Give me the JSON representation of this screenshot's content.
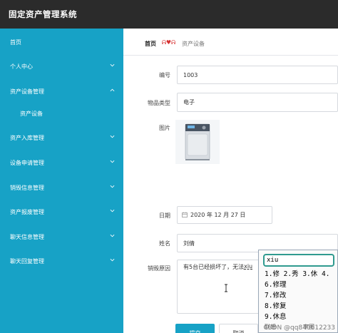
{
  "app": {
    "title": "固定资产管理系统"
  },
  "sidebar": {
    "items": [
      {
        "label": "首页",
        "chevron": ""
      },
      {
        "label": "个人中心",
        "chevron": "down"
      },
      {
        "label": "资产设备管理",
        "chevron": "up"
      },
      {
        "label": "资产设备",
        "chevron": ""
      },
      {
        "label": "资产入库管理",
        "chevron": "down"
      },
      {
        "label": "设备申请管理",
        "chevron": "down"
      },
      {
        "label": "销毁信息管理",
        "chevron": "down"
      },
      {
        "label": "资产报废管理",
        "chevron": "down"
      },
      {
        "label": "聊天信息管理",
        "chevron": "down"
      },
      {
        "label": "聊天回复管理",
        "chevron": "down"
      }
    ]
  },
  "breadcrumb": {
    "home": "首页",
    "separator": "ᕱ♥ᕱ",
    "current": "资产设备"
  },
  "form": {
    "id_label": "编号",
    "id_value": "1003",
    "type_label": "物品类型",
    "type_value": "电子",
    "image_label": "图片",
    "date_label": "日期",
    "date_value": "2020 年 12 月 27 日",
    "name_label": "姓名",
    "name_value": "刘倩",
    "reason_label": "销毁原因",
    "reason_text": "有5台已经损坏了，无法",
    "reason_composing": "xiu",
    "submit_label": "提交",
    "cancel_label": "取消"
  },
  "ime": {
    "composition": "xiu",
    "line1": "1.修  2.秀  3.休  4.",
    "candidates": [
      "6.修理",
      "7.修改",
      "8.修复",
      "9.休息"
    ],
    "partial_left": "联想",
    "partial_right": "宇图"
  },
  "watermark": "CSDN @qq840612233",
  "colors": {
    "topbar": "#2b2b2b",
    "accent": "#17a2c6",
    "ime_border": "#2f9a8f"
  }
}
